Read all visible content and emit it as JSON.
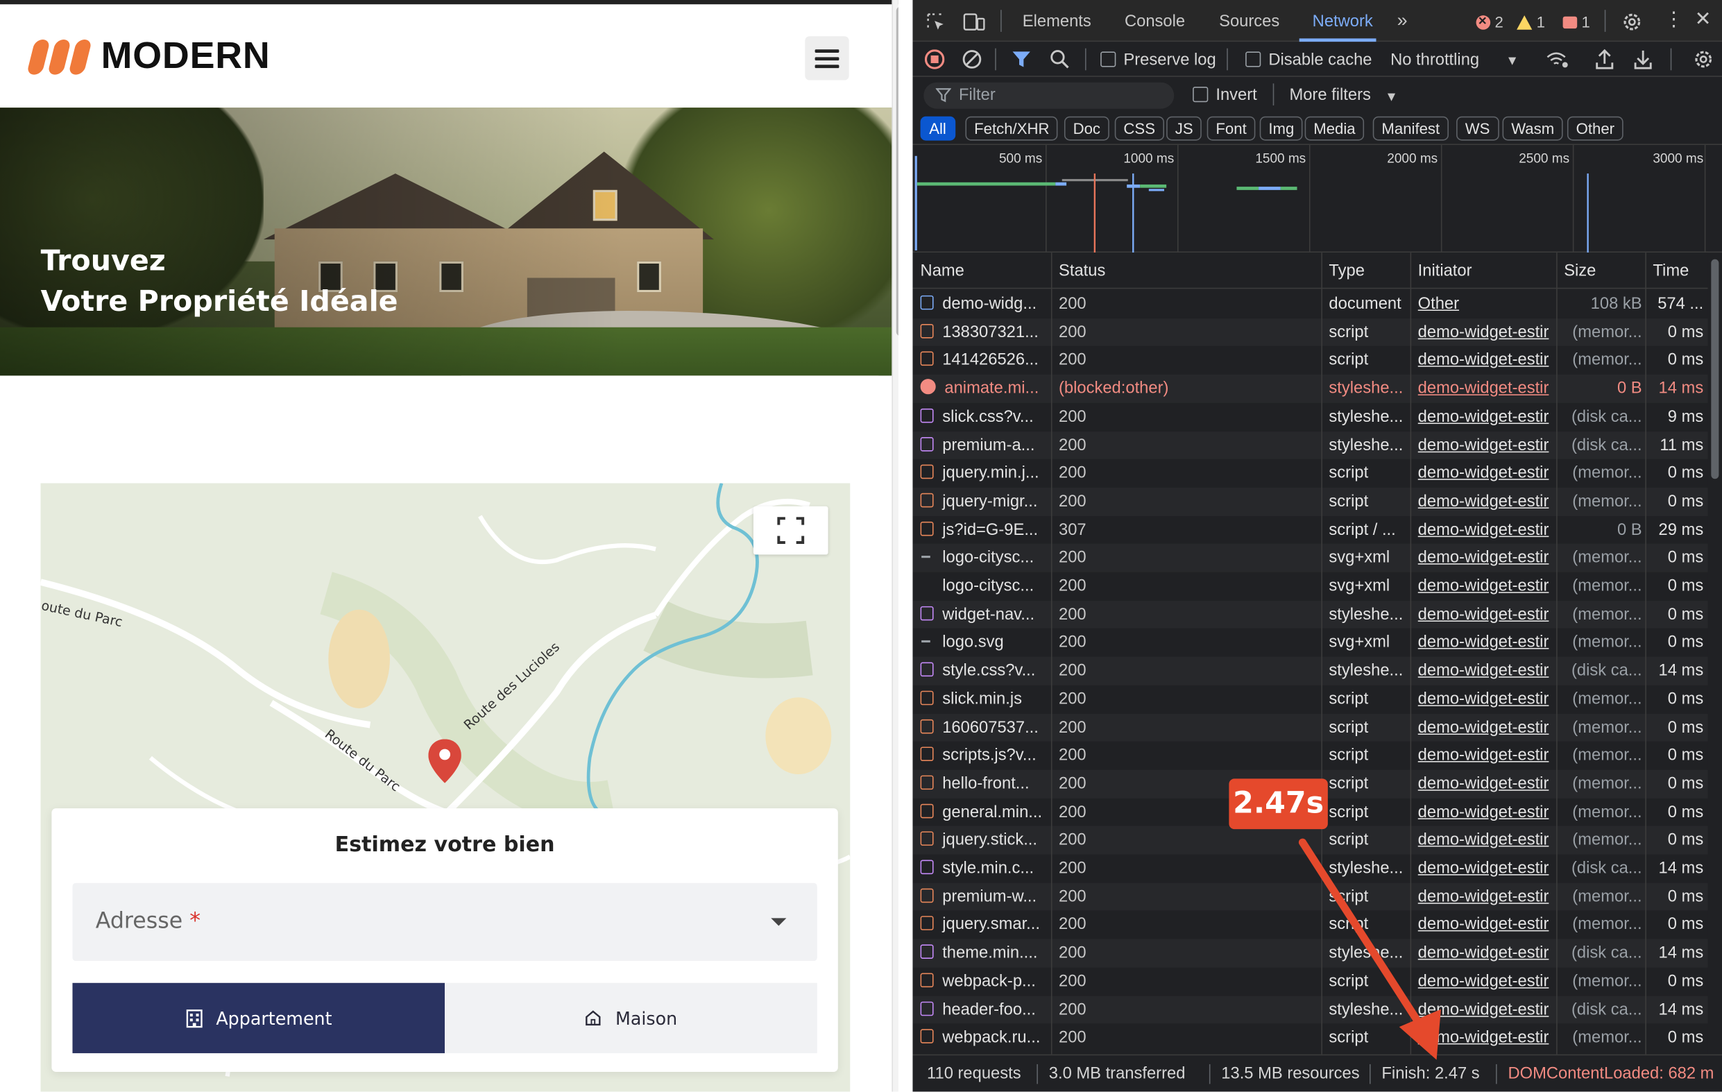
{
  "site": {
    "logo_text": "MODERN",
    "brand_color": "#f07a3a",
    "hero_line1": "Trouvez",
    "hero_line2": "Votre Propriété Idéale",
    "map_labels": [
      "oute du Parc",
      "Route des Lucioles",
      "Route du Parc"
    ],
    "estimate": {
      "title": "Estimez votre bien",
      "address_label": "Adresse",
      "required_mark": "*",
      "type_apartment": "Appartement",
      "type_house": "Maison",
      "active_color": "#2a3361"
    }
  },
  "devtools": {
    "tabs": [
      "Elements",
      "Console",
      "Sources",
      "Network"
    ],
    "active_tab": "Network",
    "errors": "2",
    "warnings": "1",
    "issues": "1",
    "toolbar": {
      "preserve_log": "Preserve log",
      "disable_cache": "Disable cache",
      "throttling": "No throttling"
    },
    "filter_placeholder": "Filter",
    "invert": "Invert",
    "more_filters": "More filters",
    "chips": [
      "All",
      "Fetch/XHR",
      "Doc",
      "CSS",
      "JS",
      "Font",
      "Img",
      "Media",
      "Manifest",
      "WS",
      "Wasm",
      "Other"
    ],
    "timeline_labels": [
      "500 ms",
      "1000 ms",
      "1500 ms",
      "2000 ms",
      "2500 ms",
      "3000 ms"
    ],
    "columns": [
      "Name",
      "Status",
      "Type",
      "Initiator",
      "Size",
      "Time"
    ],
    "rows": [
      {
        "icon": "doc",
        "name": "demo-widg...",
        "status": "200",
        "type": "document",
        "initiator": "Other",
        "size": "108 kB",
        "time": "574 ..."
      },
      {
        "icon": "js",
        "name": "138307321...",
        "status": "200",
        "type": "script",
        "initiator": "demo-widget-estir",
        "size": "(memor...",
        "time": "0 ms"
      },
      {
        "icon": "js",
        "name": "141426526...",
        "status": "200",
        "type": "script",
        "initiator": "demo-widget-estir",
        "size": "(memor...",
        "time": "0 ms"
      },
      {
        "icon": "err",
        "name": "animate.mi...",
        "status": "(blocked:other)",
        "type": "styleshe...",
        "initiator": "demo-widget-estir",
        "size": "0 B",
        "time": "14 ms"
      },
      {
        "icon": "css",
        "name": "slick.css?v...",
        "status": "200",
        "type": "styleshe...",
        "initiator": "demo-widget-estir",
        "size": "(disk ca...",
        "time": "9 ms"
      },
      {
        "icon": "css",
        "name": "premium-a...",
        "status": "200",
        "type": "styleshe...",
        "initiator": "demo-widget-estir",
        "size": "(disk ca...",
        "time": "11 ms"
      },
      {
        "icon": "js",
        "name": "jquery.min.j...",
        "status": "200",
        "type": "script",
        "initiator": "demo-widget-estir",
        "size": "(memor...",
        "time": "0 ms"
      },
      {
        "icon": "js",
        "name": "jquery-migr...",
        "status": "200",
        "type": "script",
        "initiator": "demo-widget-estir",
        "size": "(memor...",
        "time": "0 ms"
      },
      {
        "icon": "js",
        "name": "js?id=G-9E...",
        "status": "307",
        "type": "script / ...",
        "initiator": "demo-widget-estir",
        "size": "0 B",
        "time": "29 ms"
      },
      {
        "icon": "svg",
        "name": "logo-citysc...",
        "status": "200",
        "type": "svg+xml",
        "initiator": "demo-widget-estir",
        "size": "(memor...",
        "time": "0 ms"
      },
      {
        "icon": "none",
        "name": "logo-citysc...",
        "status": "200",
        "type": "svg+xml",
        "initiator": "demo-widget-estir",
        "size": "(memor...",
        "time": "0 ms"
      },
      {
        "icon": "css",
        "name": "widget-nav...",
        "status": "200",
        "type": "styleshe...",
        "initiator": "demo-widget-estir",
        "size": "(memor...",
        "time": "0 ms"
      },
      {
        "icon": "svg",
        "name": "logo.svg",
        "status": "200",
        "type": "svg+xml",
        "initiator": "demo-widget-estir",
        "size": "(memor...",
        "time": "0 ms"
      },
      {
        "icon": "css",
        "name": "style.css?v...",
        "status": "200",
        "type": "styleshe...",
        "initiator": "demo-widget-estir",
        "size": "(disk ca...",
        "time": "14 ms"
      },
      {
        "icon": "js",
        "name": "slick.min.js",
        "status": "200",
        "type": "script",
        "initiator": "demo-widget-estir",
        "size": "(memor...",
        "time": "0 ms"
      },
      {
        "icon": "js",
        "name": "160607537...",
        "status": "200",
        "type": "script",
        "initiator": "demo-widget-estir",
        "size": "(memor...",
        "time": "0 ms"
      },
      {
        "icon": "js",
        "name": "scripts.js?v...",
        "status": "200",
        "type": "script",
        "initiator": "demo-widget-estir",
        "size": "(memor...",
        "time": "0 ms"
      },
      {
        "icon": "js",
        "name": "hello-front...",
        "status": "200",
        "type": "script",
        "initiator": "demo-widget-estir",
        "size": "(memor...",
        "time": "0 ms"
      },
      {
        "icon": "js",
        "name": "general.min...",
        "status": "200",
        "type": "script",
        "initiator": "demo-widget-estir",
        "size": "(memor...",
        "time": "0 ms"
      },
      {
        "icon": "js",
        "name": "jquery.stick...",
        "status": "200",
        "type": "script",
        "initiator": "demo-widget-estir",
        "size": "(memor...",
        "time": "0 ms"
      },
      {
        "icon": "css",
        "name": "style.min.c...",
        "status": "200",
        "type": "styleshe...",
        "initiator": "demo-widget-estir",
        "size": "(disk ca...",
        "time": "14 ms"
      },
      {
        "icon": "js",
        "name": "premium-w...",
        "status": "200",
        "type": "script",
        "initiator": "demo-widget-estir",
        "size": "(memor...",
        "time": "0 ms"
      },
      {
        "icon": "js",
        "name": "jquery.smar...",
        "status": "200",
        "type": "script",
        "initiator": "demo-widget-estir",
        "size": "(memor...",
        "time": "0 ms"
      },
      {
        "icon": "css",
        "name": "theme.min....",
        "status": "200",
        "type": "styleshe...",
        "initiator": "demo-widget-estir",
        "size": "(disk ca...",
        "time": "14 ms"
      },
      {
        "icon": "js",
        "name": "webpack-p...",
        "status": "200",
        "type": "script",
        "initiator": "demo-widget-estir",
        "size": "(memor...",
        "time": "0 ms"
      },
      {
        "icon": "css",
        "name": "header-foo...",
        "status": "200",
        "type": "styleshe...",
        "initiator": "demo-widget-estir",
        "size": "(disk ca...",
        "time": "14 ms"
      },
      {
        "icon": "js",
        "name": "webpack.ru...",
        "status": "200",
        "type": "script",
        "initiator": "demo-widget-estir",
        "size": "(memor...",
        "time": "0 ms"
      }
    ],
    "status_bar": {
      "requests": "110 requests",
      "transferred": "3.0 MB transferred",
      "resources": "13.5 MB resources",
      "finish": "Finish: 2.47 s",
      "dom_loaded": "DOMContentLoaded: 682 m"
    }
  },
  "annotation": {
    "label": "2.47s",
    "color": "#e5492c"
  }
}
